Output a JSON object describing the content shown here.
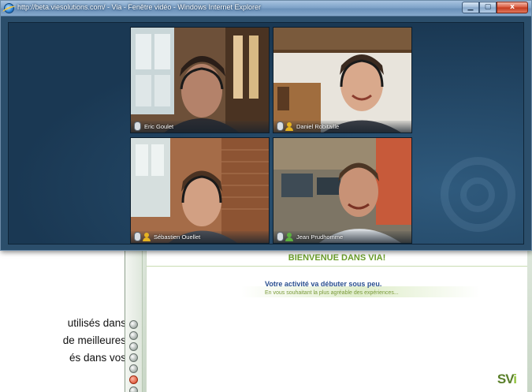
{
  "document": {
    "lines": [
      "utilisés dans",
      "de meilleures",
      "és dans vos"
    ]
  },
  "ie_window": {
    "title": "http://beta.viesolutions.com/ - Via - Fenêtre vidéo - Windows Internet Explorer",
    "minimize_icon": "minimize-icon",
    "maximize_icon": "maximize-icon",
    "close_label": "x"
  },
  "participants": [
    {
      "name": "Eric Goulet",
      "status_color": "#e6b321"
    },
    {
      "name": "Daniel Robitaille",
      "status_color": "#e6b321"
    },
    {
      "name": "Sébastien Ouellet",
      "status_color": "#e6b321"
    },
    {
      "name": "Jean Prudhomme",
      "status_color": "#5cb040"
    }
  ],
  "via_app": {
    "welcome": "BIENVENUE DANS VIA!",
    "activity_title": "Votre activité va débuter sous peu.",
    "activity_subtitle": "En vous souhaitant la plus agréable des expériences...",
    "logo_text": "SV",
    "logo_accent": "i"
  },
  "colors": {
    "accent_green": "#6b9e2b",
    "video_bg": "#1a3853",
    "link_blue": "#2a4f8f"
  }
}
